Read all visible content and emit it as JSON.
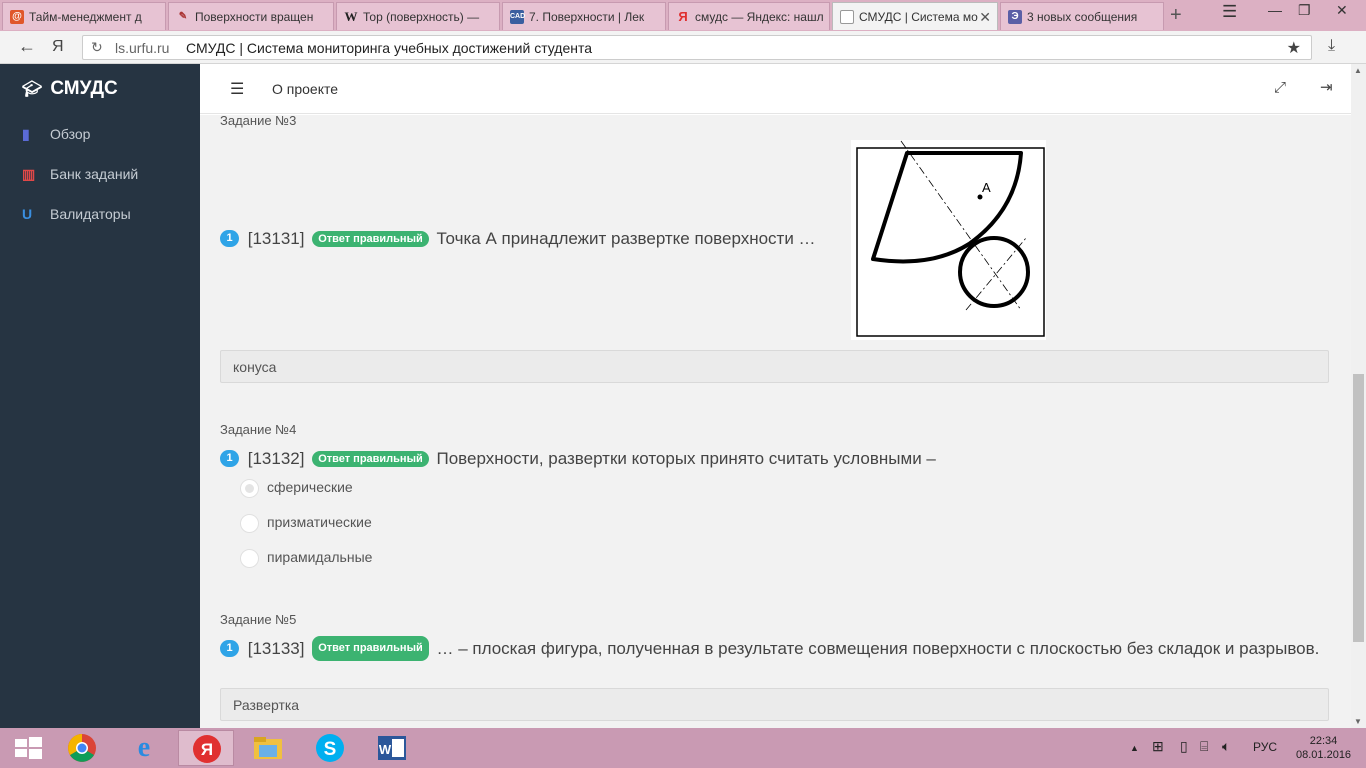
{
  "browser": {
    "tabs": [
      {
        "label": "Тайм-менеджмент д",
        "icon": "orange-spiral-icon"
      },
      {
        "label": "Поверхности вращен",
        "icon": "pen-icon"
      },
      {
        "label": "Тор (поверхность) —",
        "icon": "wikipedia-icon"
      },
      {
        "label": "7. Поверхности | Лек",
        "icon": "cad-icon"
      },
      {
        "label": "смудс — Яндекс: нашл",
        "icon": "yandex-icon"
      },
      {
        "label": "СМУДС | Система мо",
        "icon": "page-icon",
        "active": true
      },
      {
        "label": "3 новых сообщения",
        "icon": "mail-icon"
      }
    ],
    "address": {
      "domain": "ls.urfu.ru",
      "title": "СМУДС | Система мониторинга учебных достижений студента"
    }
  },
  "sidebar": {
    "brand": "СМУДС",
    "items": [
      {
        "label": "Обзор",
        "icon": "bar-chart-icon",
        "color": "#5b6bd6"
      },
      {
        "label": "Банк заданий",
        "icon": "bank-icon",
        "color": "#e04848"
      },
      {
        "label": "Валидаторы",
        "icon": "magnet-icon",
        "color": "#3a8fe0"
      }
    ]
  },
  "header": {
    "about": "О проекте"
  },
  "tasks": {
    "t3": {
      "title": "Задание №3",
      "num": "1",
      "id": "[13131]",
      "status": "Ответ правильный",
      "question": "Точка А принадлежит развертке поверхности …",
      "figure_label": "А",
      "answer": "конуса"
    },
    "t4": {
      "title": "Задание №4",
      "num": "1",
      "id": "[13132]",
      "status": "Ответ правильный",
      "question": "Поверхности, развертки которых принято считать условными –",
      "options": [
        "сферические",
        "призматические",
        "пирамидальные"
      ],
      "selected": 0
    },
    "t5": {
      "title": "Задание №5",
      "num": "1",
      "id": "[13133]",
      "status": "Ответ правильный",
      "question": "… – плоская фигура, полученная в результате совмещения поверхности с плоскостью без складок и разрывов.",
      "answer": "Развертка"
    }
  },
  "taskbar": {
    "apps": [
      "windows-start-icon",
      "chrome-icon",
      "internet-explorer-icon",
      "yandex-browser-icon",
      "file-explorer-icon",
      "skype-icon",
      "word-icon"
    ],
    "lang": "РУС",
    "time": "22:34",
    "date": "08.01.2016"
  },
  "colors": {
    "sidebar_bg": "#263442",
    "badge_blue": "#2fa4e7",
    "badge_green": "#3cb371",
    "taskbar": "#c99ab3"
  }
}
